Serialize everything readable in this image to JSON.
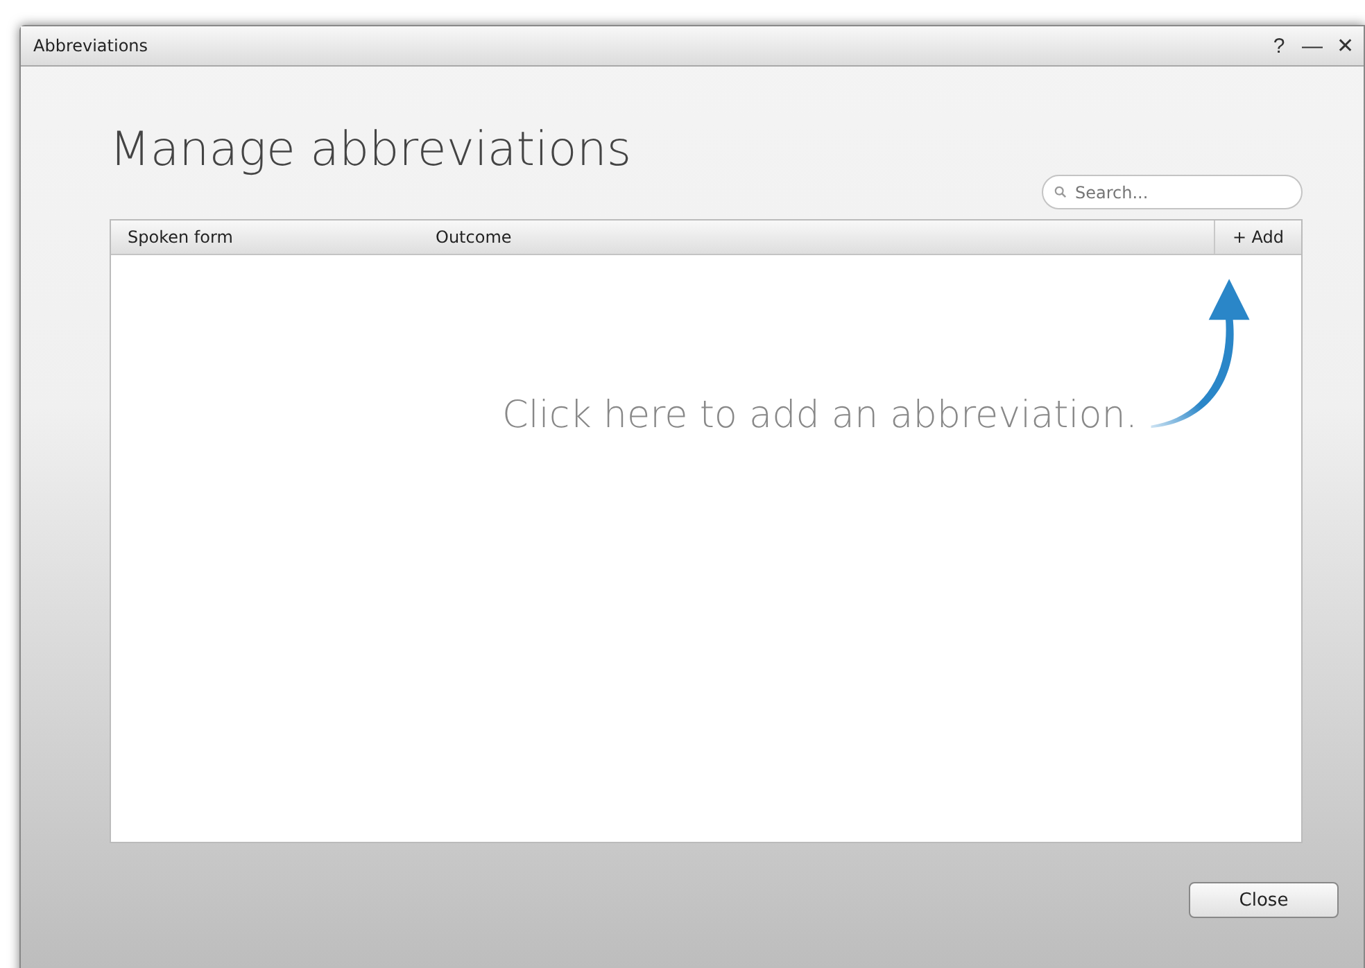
{
  "window": {
    "title": "Abbreviations",
    "controls": [
      "?",
      "—",
      "✕"
    ]
  },
  "heading": "Manage abbreviations",
  "search": {
    "placeholder": "Search..."
  },
  "table": {
    "columns": [
      "Spoken form",
      "Outcome"
    ],
    "add_button": "+ Add",
    "hint": "Click here to add an abbreviation."
  },
  "buttons": [
    "Close"
  ]
}
